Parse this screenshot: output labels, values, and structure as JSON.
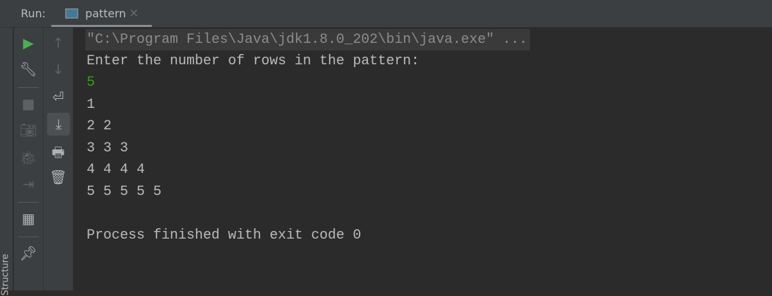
{
  "header": {
    "run_label": "Run:",
    "tab_label": "pattern",
    "tab_close": "×"
  },
  "sidebar": {
    "structure_label": "Structure"
  },
  "console": {
    "command": "\"C:\\Program Files\\Java\\jdk1.8.0_202\\bin\\java.exe\" ...",
    "prompt": "Enter the number of rows in the pattern:",
    "input": "5",
    "output": [
      "1",
      "2 2",
      "3 3 3",
      "4 4 4 4",
      "5 5 5 5 5"
    ],
    "exit": "Process finished with exit code 0"
  },
  "colors": {
    "accent_run": "#4caf50",
    "input": "#389b1f"
  }
}
